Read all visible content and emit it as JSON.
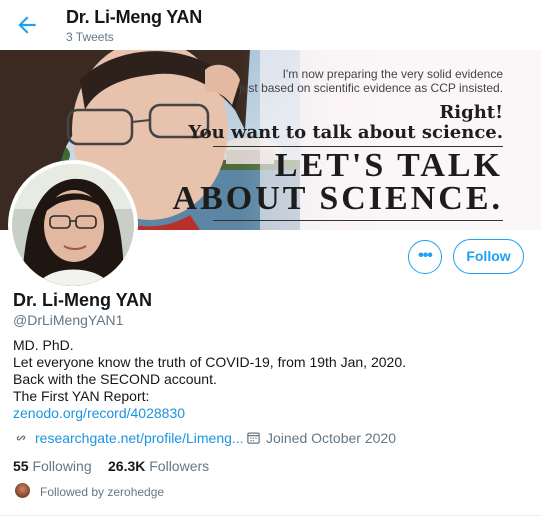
{
  "header": {
    "name": "Dr. Li-Meng YAN",
    "tweet_count": "3 Tweets"
  },
  "banner": {
    "line1": "I'm now preparing the very solid evidence",
    "line2": "just based on scientific evidence as CCP insisted.",
    "line3": "Right!",
    "line4": "You want to talk about science.",
    "line5": "LET'S TALK",
    "line6": "ABOUT SCIENCE."
  },
  "profile": {
    "name": "Dr. Li-Meng YAN",
    "handle": "@DrLiMengYAN1",
    "bio_lines": [
      "MD. PhD.",
      "Let everyone know the truth of COVID-19, from 19th Jan, 2020.",
      "Back with the SECOND account.",
      "The First YAN Report:"
    ],
    "bio_link": "zenodo.org/record/4028830",
    "website": "researchgate.net/profile/Limeng...",
    "joined": "Joined October 2020"
  },
  "actions": {
    "more_label": "•••",
    "follow_label": "Follow"
  },
  "stats": {
    "following_count": "55",
    "following_label": "Following",
    "followers_count": "26.3K",
    "followers_label": "Followers"
  },
  "followed_by": "Followed by zerohedge",
  "colors": {
    "accent": "#1da1f2",
    "link": "#1b95e0",
    "secondary_text": "#657786"
  },
  "icons": [
    "back-arrow-icon",
    "link-icon",
    "calendar-icon",
    "more-icon"
  ]
}
